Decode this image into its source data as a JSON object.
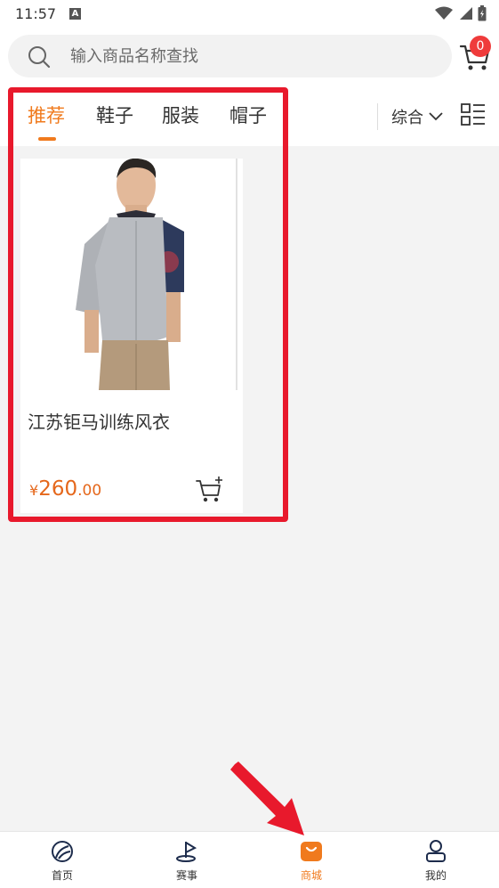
{
  "status_bar": {
    "time": "11:57",
    "indicator": "A"
  },
  "search": {
    "placeholder": "输入商品名称查找"
  },
  "cart": {
    "badge_count": "0"
  },
  "tabs": [
    {
      "label": "推荐",
      "active": true
    },
    {
      "label": "鞋子",
      "active": false
    },
    {
      "label": "服装",
      "active": false
    },
    {
      "label": "帽子",
      "active": false
    }
  ],
  "sort": {
    "label": "综合"
  },
  "products": [
    {
      "name": "江苏钜马训练风衣",
      "currency": "¥",
      "price_int": "260",
      "price_dec": ".00"
    }
  ],
  "bottom_nav": [
    {
      "label": "首页",
      "icon": "home-icon"
    },
    {
      "label": "赛事",
      "icon": "golf-flag-icon"
    },
    {
      "label": "商城",
      "icon": "shop-bag-icon",
      "active": true
    },
    {
      "label": "我的",
      "icon": "user-icon"
    }
  ],
  "colors": {
    "accent": "#f07a1d",
    "highlight": "#e8192c",
    "badge": "#ef3b3b"
  }
}
